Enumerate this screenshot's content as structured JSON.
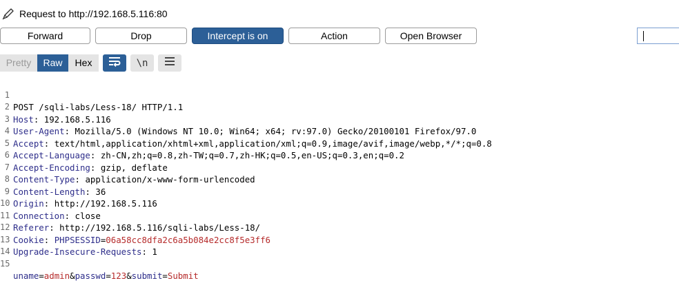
{
  "header": {
    "title": "Request to http://192.168.5.116:80"
  },
  "toolbar": {
    "forward": "Forward",
    "drop": "Drop",
    "intercept": "Intercept is on",
    "action": "Action",
    "open_browser": "Open Browser"
  },
  "search": {
    "value": ""
  },
  "view_tabs": {
    "pretty": "Pretty",
    "raw": "Raw",
    "hex": "Hex",
    "newline_toggle": "\\n",
    "active": "Raw"
  },
  "colors": {
    "accent": "#2c5f97",
    "header_name": "#2d2d8a",
    "param_value": "#b52a2a",
    "line_number": "#6a6a6a"
  },
  "icons": [
    "pencil-icon",
    "wrap-lines-icon",
    "newline-icon",
    "menu-icon"
  ],
  "request": {
    "request_line": "POST /sqli-labs/Less-18/ HTTP/1.1",
    "headers": [
      {
        "name": "Host",
        "value": "192.168.5.116"
      },
      {
        "name": "User-Agent",
        "value": "Mozilla/5.0 (Windows NT 10.0; Win64; x64; rv:97.0) Gecko/20100101 Firefox/97.0"
      },
      {
        "name": "Accept",
        "value": "text/html,application/xhtml+xml,application/xml;q=0.9,image/avif,image/webp,*/*;q=0.8"
      },
      {
        "name": "Accept-Language",
        "value": "zh-CN,zh;q=0.8,zh-TW;q=0.7,zh-HK;q=0.5,en-US;q=0.3,en;q=0.2"
      },
      {
        "name": "Accept-Encoding",
        "value": "gzip, deflate"
      },
      {
        "name": "Content-Type",
        "value": "application/x-www-form-urlencoded"
      },
      {
        "name": "Content-Length",
        "value": "36"
      },
      {
        "name": "Origin",
        "value": "http://192.168.5.116"
      },
      {
        "name": "Connection",
        "value": "close"
      },
      {
        "name": "Referer",
        "value": "http://192.168.5.116/sqli-labs/Less-18/"
      }
    ],
    "cookie": {
      "name": "Cookie",
      "cookie_name": "PHPSESSID",
      "cookie_value": "06a58cc8dfa2c6a5b084e2cc8f5e3ff6"
    },
    "upgrade": {
      "name": "Upgrade-Insecure-Requests",
      "value": "1"
    },
    "body_params": [
      {
        "name": "uname",
        "value": "admin"
      },
      {
        "name": "passwd",
        "value": "123"
      },
      {
        "name": "submit",
        "value": "Submit"
      }
    ],
    "line_numbers": [
      "1",
      "2",
      "3",
      "4",
      "5",
      "6",
      "7",
      "8",
      "9",
      "10",
      "11",
      "12",
      "13",
      "14",
      "15"
    ]
  }
}
